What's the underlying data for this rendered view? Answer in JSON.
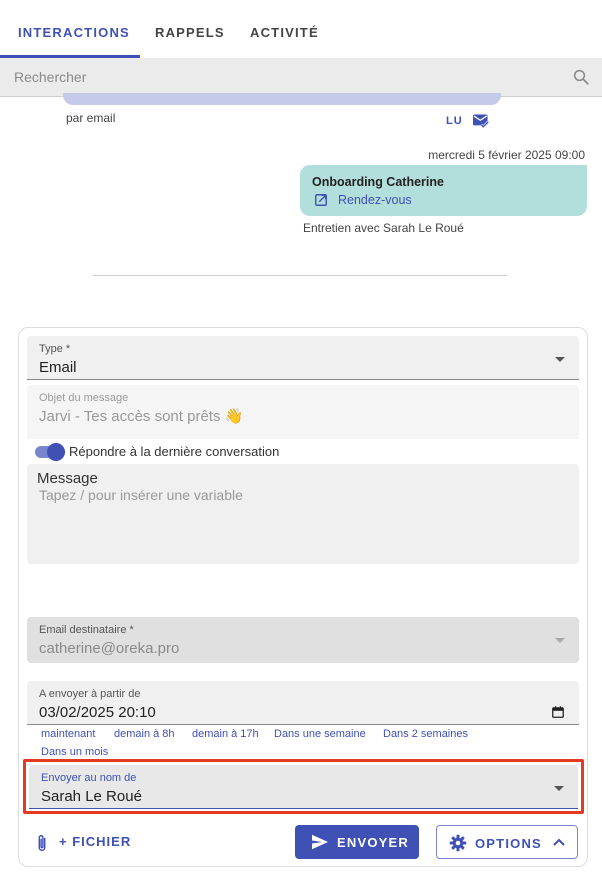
{
  "tabs": [
    {
      "label": "INTERACTIONS",
      "active": true
    },
    {
      "label": "RAPPELS",
      "active": false
    },
    {
      "label": "ACTIVITÉ",
      "active": false
    }
  ],
  "search": {
    "placeholder": "Rechercher",
    "icon": "search-icon"
  },
  "timeline": {
    "previous": {
      "channel": "par email",
      "status": "LU",
      "status_icon": "mark-email-read-icon"
    },
    "event": {
      "date": "mercredi 5 février 2025 09:00",
      "title": "Onboarding Catherine",
      "link_label": "Rendez-vous",
      "link_icon": "open-in-new-icon",
      "caption": "Entretien avec Sarah Le Roué"
    }
  },
  "composer": {
    "type": {
      "label": "Type *",
      "value": "Email"
    },
    "subject": {
      "label": "Objet du message",
      "value": "Jarvi - Tes accès sont prêts 👋"
    },
    "reply_toggle": {
      "label": "Répondre à la dernière conversation",
      "checked": true
    },
    "message": {
      "label": "Message",
      "placeholder": "Tapez / pour insérer une variable"
    },
    "recipient": {
      "label": "Email destinataire *",
      "value": "catherine@oreka.pro"
    },
    "send_from": {
      "label": "A envoyer à partir de",
      "value": "03/02/2025 20:10"
    },
    "quick_dates": [
      "maintenant",
      "demain à 8h",
      "demain à 17h",
      "Dans une semaine",
      "Dans 2 semaines",
      "Dans un mois"
    ],
    "sender": {
      "label": "Envoyer au nom de",
      "value": "Sarah Le Roué"
    },
    "actions": {
      "file": "+ FICHIER",
      "send": "ENVOYER",
      "options": "OPTIONS"
    }
  },
  "colors": {
    "primary": "#3f51b5",
    "event_bg": "#b2dfdb",
    "highlight": "#e53920"
  }
}
